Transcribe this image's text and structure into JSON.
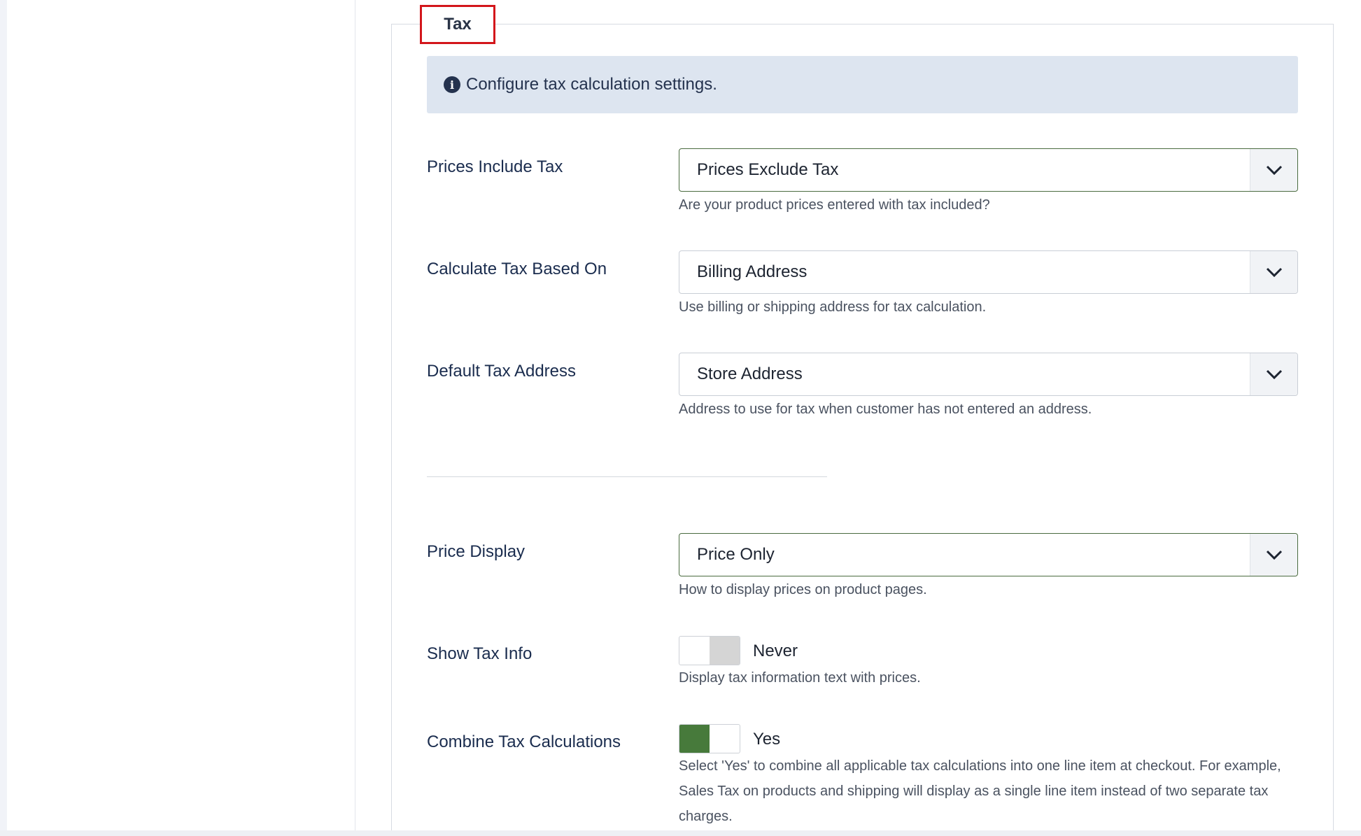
{
  "tab": {
    "label": "Tax"
  },
  "info": {
    "text": "Configure tax calculation settings."
  },
  "fields": [
    {
      "label": "Prices Include Tax",
      "value": "Prices Exclude Tax",
      "help": "Are your product prices entered with tax included?"
    },
    {
      "label": "Calculate Tax Based On",
      "value": "Billing Address",
      "help": "Use billing or shipping address for tax calculation."
    },
    {
      "label": "Default Tax Address",
      "value": "Store Address",
      "help": "Address to use for tax when customer has not entered an address."
    },
    {
      "label": "Price Display",
      "value": "Price Only",
      "help": "How to display prices on product pages."
    },
    {
      "label": "Show Tax Info",
      "value": "Never",
      "help": "Display tax information text with prices."
    },
    {
      "label": "Combine Tax Calculations",
      "value": "Yes",
      "help": "Select 'Yes' to combine all applicable tax calculations into one line item at checkout. For example, Sales Tax on products and shipping will display as a single line item instead of two separate tax charges."
    }
  ],
  "colors": {
    "accent_green": "#477a3b",
    "highlight_red": "#d3161b",
    "info_bg": "#dde5f0"
  },
  "icons": {
    "info": "info-circle-icon",
    "dropdown": "chevron-down-icon"
  }
}
